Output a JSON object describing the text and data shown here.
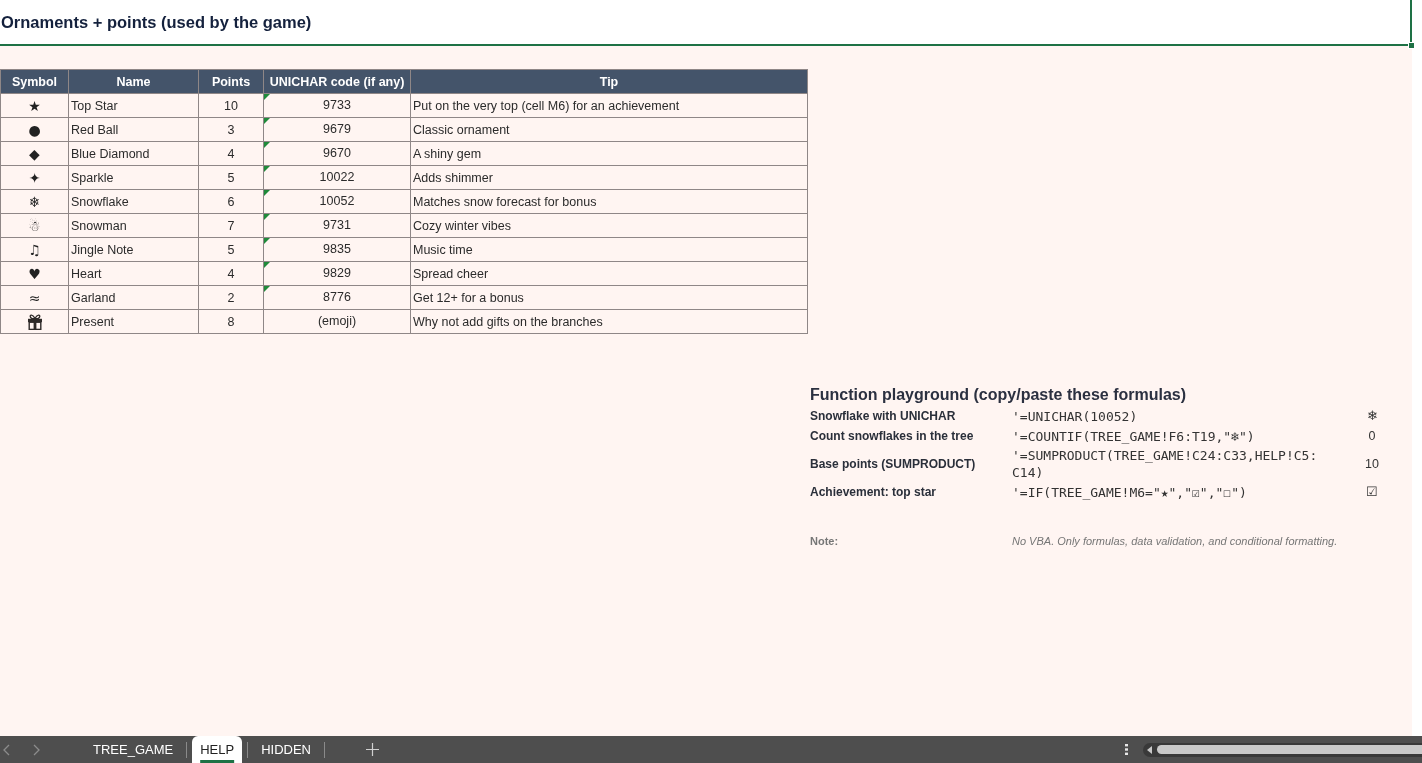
{
  "title": "Ornaments + points (used by the game)",
  "table": {
    "columns": [
      "Symbol",
      "Name",
      "Points",
      "UNICHAR code (if any)",
      "Tip"
    ],
    "rows": [
      {
        "kind": "glyph",
        "symbol": "★",
        "name": "Top Star",
        "points": "10",
        "code": "9733",
        "code_flagged": true,
        "tip": "Put on the very top (cell M6) for an achievement"
      },
      {
        "kind": "glyph",
        "symbol": "●",
        "name": "Red Ball",
        "points": "3",
        "code": "9679",
        "code_flagged": true,
        "tip": "Classic ornament"
      },
      {
        "kind": "glyph",
        "symbol": "◆",
        "name": "Blue Diamond",
        "points": "4",
        "code": "9670",
        "code_flagged": true,
        "tip": "A shiny gem"
      },
      {
        "kind": "glyph",
        "symbol": "✦",
        "name": "Sparkle",
        "points": "5",
        "code": "10022",
        "code_flagged": true,
        "tip": "Adds shimmer"
      },
      {
        "kind": "glyph",
        "symbol": "❄",
        "name": "Snowflake",
        "points": "6",
        "code": "10052",
        "code_flagged": true,
        "tip": "Matches snow forecast for bonus"
      },
      {
        "kind": "glyph",
        "symbol": "☃",
        "name": "Snowman",
        "points": "7",
        "code": "9731",
        "code_flagged": true,
        "tip": "Cozy winter vibes"
      },
      {
        "kind": "glyph",
        "symbol": "♫",
        "name": "Jingle Note",
        "points": "5",
        "code": "9835",
        "code_flagged": true,
        "tip": "Music time"
      },
      {
        "kind": "glyph",
        "symbol": "♥",
        "name": "Heart",
        "points": "4",
        "code": "9829",
        "code_flagged": true,
        "tip": "Spread cheer"
      },
      {
        "kind": "glyph",
        "symbol": "≈",
        "name": "Garland",
        "points": "2",
        "code": "8776",
        "code_flagged": true,
        "tip": "Get 12+ for a bonus"
      },
      {
        "kind": "emoji",
        "name": "Present",
        "points": "8",
        "code": "(emoji)",
        "code_flagged": false,
        "tip": "Why not add gifts on the branches"
      }
    ]
  },
  "playground": {
    "title": "Function playground (copy/paste these formulas)",
    "rows": [
      {
        "label": "Snowflake with UNICHAR",
        "formula": "'=UNICHAR(10052)",
        "result": "❄"
      },
      {
        "label": "Count snowflakes in the tree",
        "formula": "'=COUNTIF(TREE_GAME!F6:T19,\"❄\")",
        "result": "0"
      },
      {
        "label": "Base points (SUMPRODUCT)",
        "formula": "'=SUMPRODUCT(TREE_GAME!C24:C33,HELP!C5:C14)",
        "result": "10"
      },
      {
        "label": "Achievement: top star",
        "formula": "'=IF(TREE_GAME!M6=\"★\",\"☑\",\"☐\")",
        "result": "☑"
      }
    ],
    "note": {
      "label": "Note:",
      "text": "No VBA. Only formulas, data validation, and conditional formatting."
    }
  },
  "sheet_tabs": [
    {
      "label": "TREE_GAME",
      "selected": false
    },
    {
      "label": "HELP",
      "selected": true
    },
    {
      "label": "HIDDEN",
      "selected": false
    }
  ]
}
